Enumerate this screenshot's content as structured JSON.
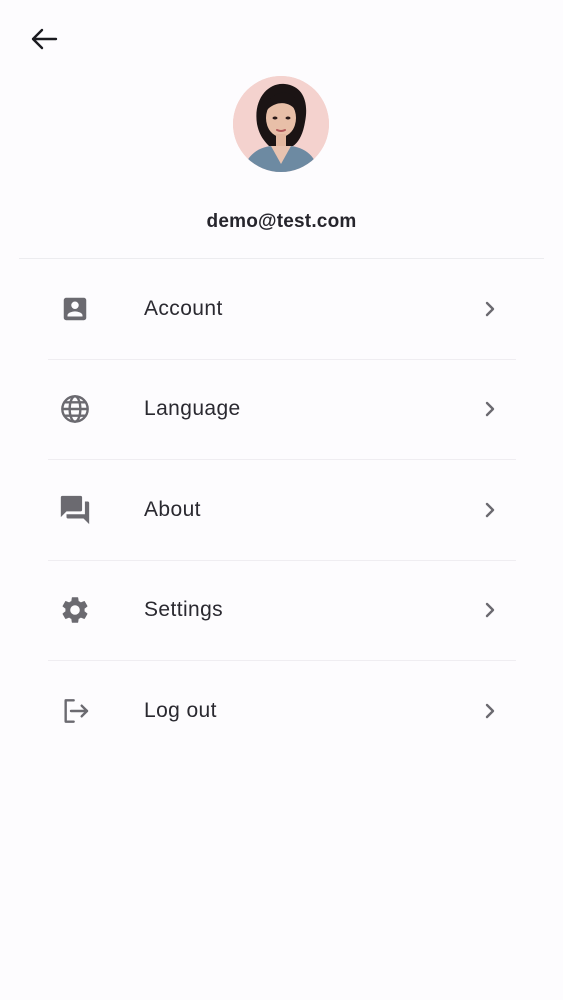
{
  "header": {
    "back_icon": "arrow-left-icon"
  },
  "profile": {
    "avatar": "user-photo",
    "email": "demo@test.com"
  },
  "menu": {
    "items": [
      {
        "label": "Account",
        "icon": "account-box-icon"
      },
      {
        "label": "Language",
        "icon": "globe-icon"
      },
      {
        "label": "About",
        "icon": "forum-icon"
      },
      {
        "label": "Settings",
        "icon": "gear-icon"
      },
      {
        "label": "Log out",
        "icon": "logout-icon"
      }
    ]
  },
  "colors": {
    "background": "#fdfcfe",
    "icon": "#6b6a70",
    "chevron": "#6b6a70",
    "divider": "#efedf1",
    "text": "#2a2930"
  }
}
